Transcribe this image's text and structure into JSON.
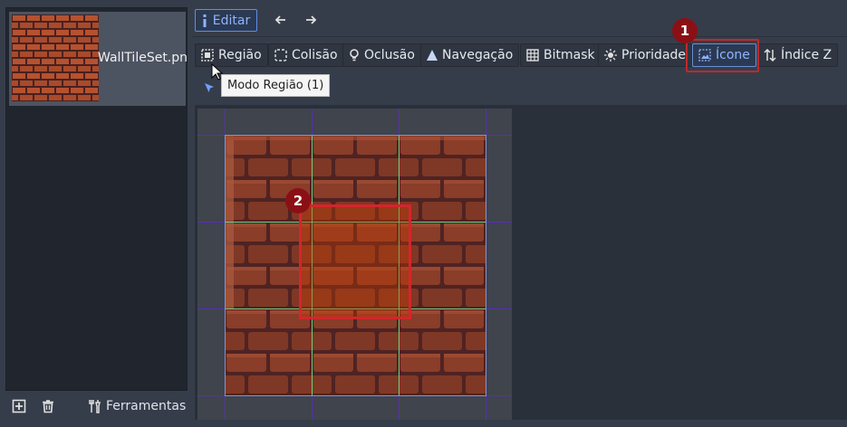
{
  "tileset": {
    "name": "WallTileSet.pn"
  },
  "toolbar": {
    "edit_label": "Editar"
  },
  "modes": [
    {
      "label": "Região",
      "icon": "region-icon",
      "active": false
    },
    {
      "label": "Colisão",
      "icon": "collision-icon",
      "active": false
    },
    {
      "label": "Oclusão",
      "icon": "occlusion-icon",
      "active": false
    },
    {
      "label": "Navegação",
      "icon": "navigation-icon",
      "active": false
    },
    {
      "label": "Bitmask",
      "icon": "bitmask-icon",
      "active": false
    },
    {
      "label": "Prioridade",
      "icon": "priority-icon",
      "active": false
    },
    {
      "label": "Ícone",
      "icon": "icon-mode-icon",
      "active": true
    },
    {
      "label": "Índice Z",
      "icon": "z-index-icon",
      "active": false
    }
  ],
  "tooltip": "Modo Região (1)",
  "bottom_bar": {
    "tools_label": "Ferramentas"
  },
  "callouts": [
    "1",
    "2"
  ],
  "colors": {
    "accent": "#8fb3ff",
    "callout": "#8b1015",
    "callout_border": "#c0282c",
    "grid": "#5a2cbd"
  }
}
